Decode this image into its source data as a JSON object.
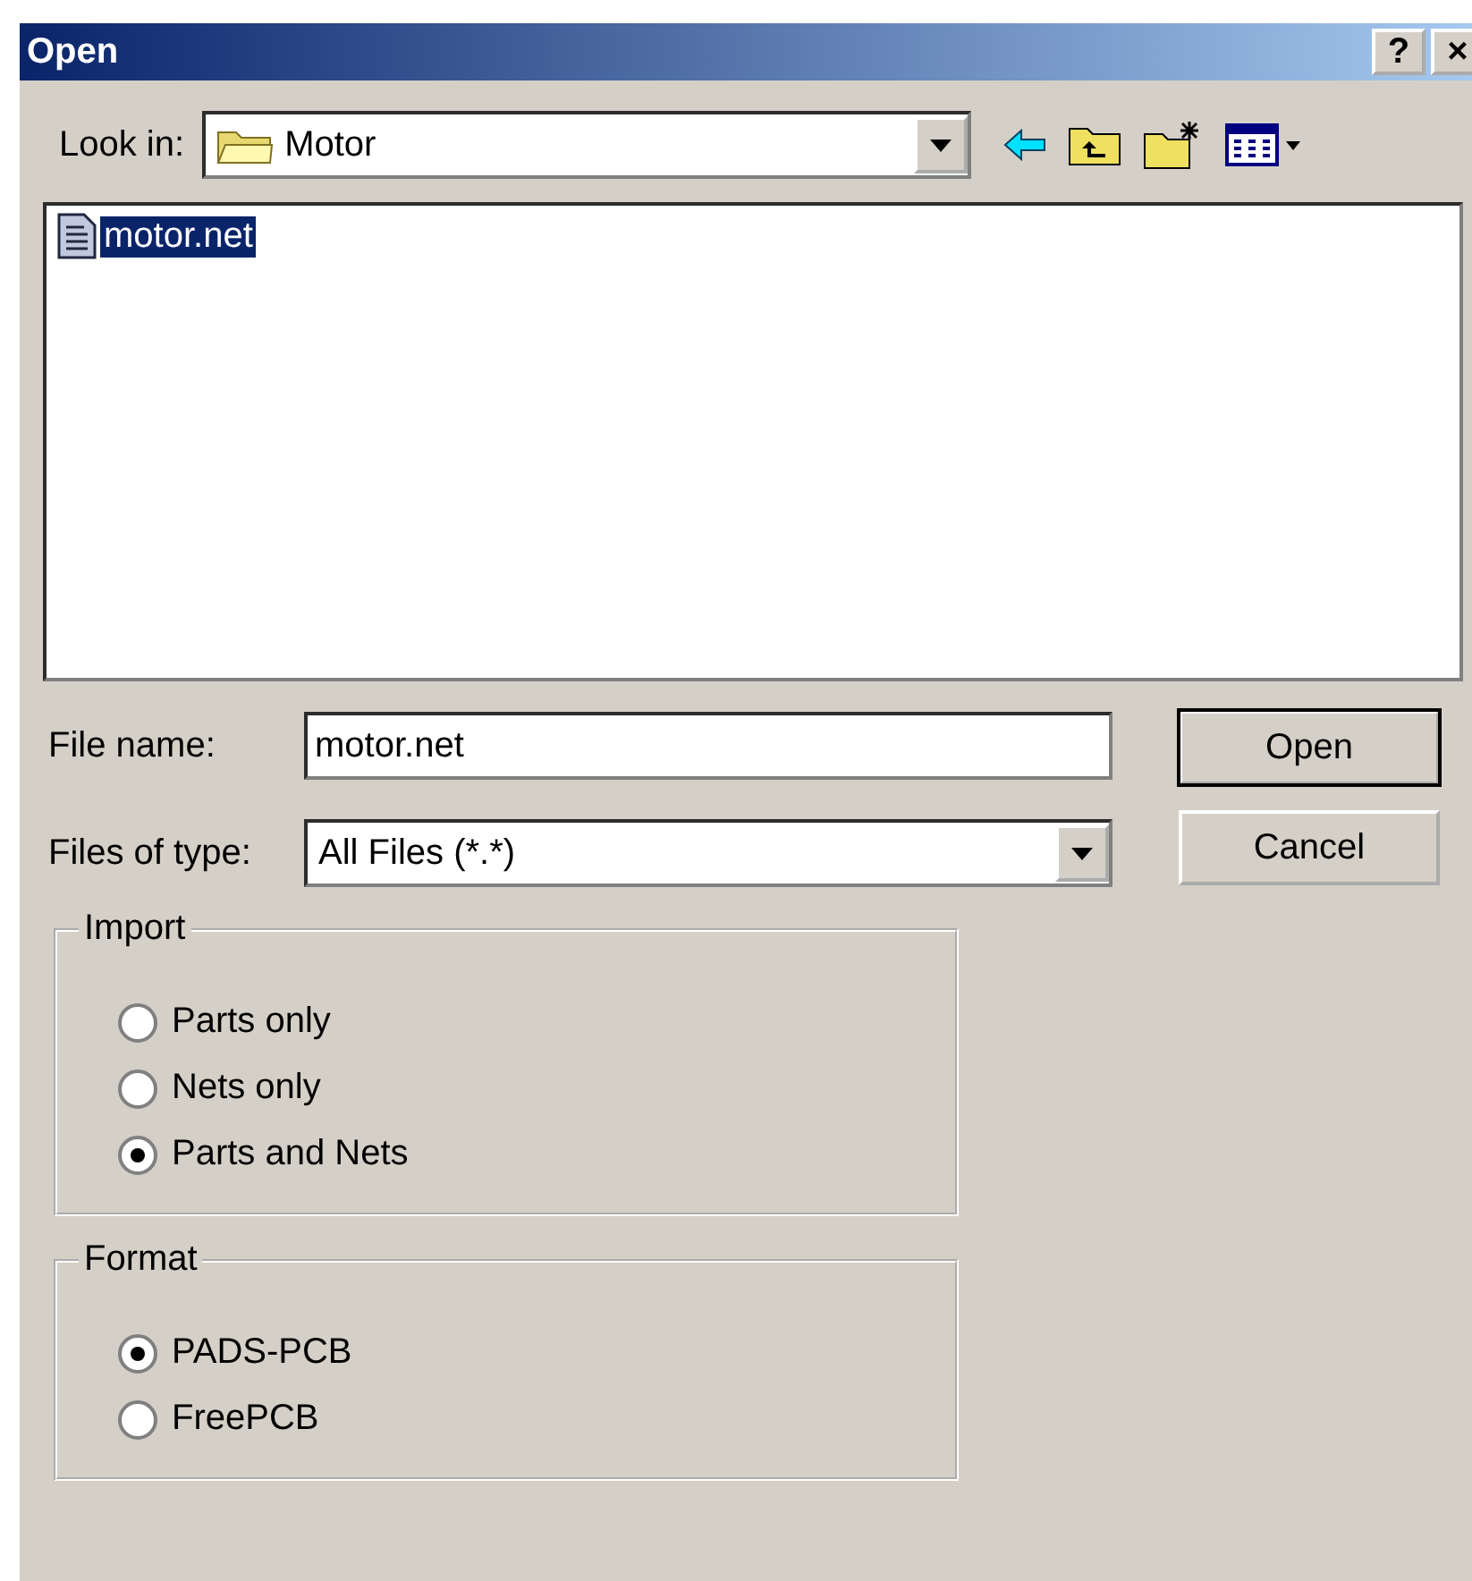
{
  "window": {
    "title": "Open",
    "buttons": [
      "?",
      "×"
    ]
  },
  "look_in": {
    "label": "Look in:",
    "value": "Motor"
  },
  "files": [
    {
      "name": "motor.net",
      "selected": true
    }
  ],
  "file_name": {
    "label": "File name:",
    "value": "motor.net"
  },
  "files_of_type": {
    "label": "Files of type:",
    "value": "All Files (*.*)"
  },
  "buttons": [
    {
      "label": "Open",
      "default": true
    },
    {
      "label": "Cancel",
      "default": false
    }
  ],
  "groups": [
    {
      "title": "Import",
      "options": [
        {
          "label": "Parts only",
          "selected": false
        },
        {
          "label": "Nets only",
          "selected": false
        },
        {
          "label": "Parts and Nets",
          "selected": true
        }
      ]
    },
    {
      "title": "Format",
      "options": [
        {
          "label": "PADS-PCB",
          "selected": true
        },
        {
          "label": "FreePCB",
          "selected": false
        }
      ]
    }
  ]
}
